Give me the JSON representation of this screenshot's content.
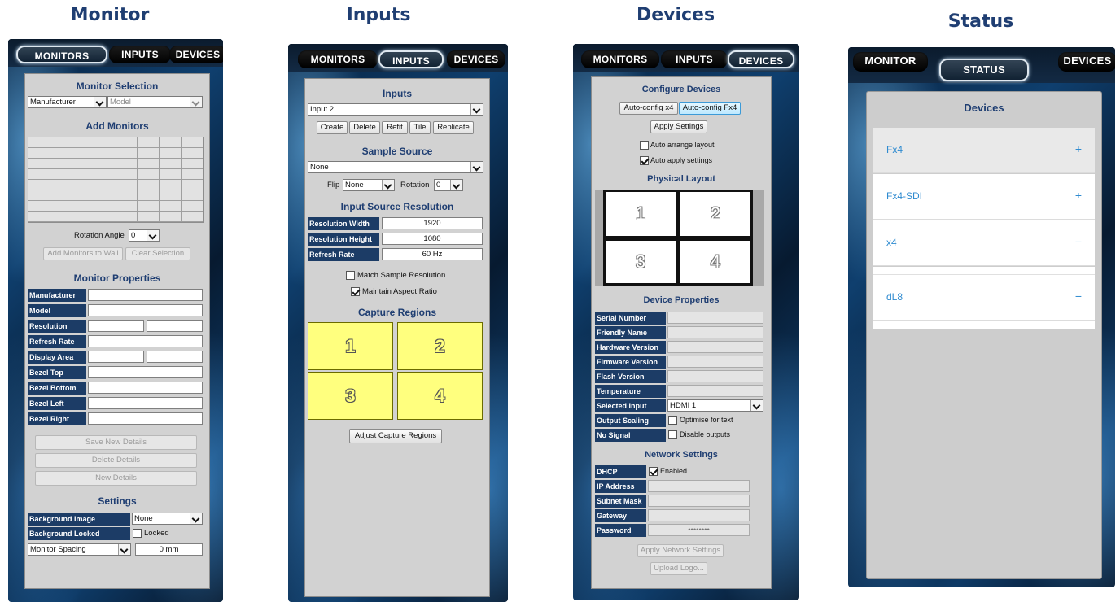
{
  "titles": [
    "Monitor",
    "Inputs",
    "Devices",
    "Status"
  ],
  "tabs": {
    "monitors": "MONITORS",
    "inputs": "INPUTS",
    "devices": "DEVICES",
    "monitor_short": "MONITOR",
    "status": "STATUS"
  },
  "monitor": {
    "selection_title": "Monitor Selection",
    "manufacturer": "Manufacturer",
    "model": "Model",
    "add_title": "Add Monitors",
    "rotation_label": "Rotation Angle",
    "rotation_value": "0",
    "add_wall": "Add Monitors to Wall",
    "clear_selection": "Clear Selection",
    "props_title": "Monitor Properties",
    "props": [
      "Manufacturer",
      "Model",
      "Resolution",
      "Refresh Rate",
      "Display Area",
      "Bezel Top",
      "Bezel Bottom",
      "Bezel Left",
      "Bezel Right"
    ],
    "save": "Save New Details",
    "delete": "Delete Details",
    "new": "New Details",
    "settings_title": "Settings",
    "bg_image_label": "Background Image",
    "bg_image_value": "None",
    "bg_locked_label": "Background Locked",
    "locked": "Locked",
    "spacing_label": "Monitor Spacing",
    "spacing_value": "0 mm"
  },
  "inputs": {
    "title": "Inputs",
    "selected_input": "Input 2",
    "buttons": [
      "Create",
      "Delete",
      "Refit",
      "Tile",
      "Replicate"
    ],
    "sample_title": "Sample Source",
    "sample_value": "None",
    "flip_label": "Flip",
    "flip_value": "None",
    "rotation_label": "Rotation",
    "rotation_value": "0",
    "res_title": "Input Source Resolution",
    "res_rows": [
      {
        "label": "Resolution Width",
        "value": "1920"
      },
      {
        "label": "Resolution Height",
        "value": "1080"
      },
      {
        "label": "Refresh Rate",
        "value": "60 Hz"
      }
    ],
    "match_sample": "Match Sample Resolution",
    "maintain_aspect": "Maintain Aspect Ratio",
    "capture_title": "Capture Regions",
    "regions": [
      "1",
      "2",
      "3",
      "4"
    ],
    "adjust": "Adjust Capture Regions"
  },
  "devices": {
    "config_title": "Configure Devices",
    "auto_x4": "Auto-config x4",
    "auto_fx4": "Auto-config Fx4",
    "apply_settings": "Apply Settings",
    "auto_arrange": "Auto arrange layout",
    "auto_apply": "Auto apply settings",
    "layout_title": "Physical Layout",
    "cells": [
      "1",
      "2",
      "3",
      "4"
    ],
    "props_title": "Device Properties",
    "props": [
      "Serial Number",
      "Friendly Name",
      "Hardware Version",
      "Firmware Version",
      "Flash Version",
      "Temperature"
    ],
    "selected_input_label": "Selected Input",
    "selected_input_value": "HDMI 1",
    "output_scaling_label": "Output Scaling",
    "optimise": "Optimise for text",
    "no_signal_label": "No Signal",
    "disable_outputs": "Disable outputs",
    "net_title": "Network Settings",
    "dhcp_label": "DHCP",
    "enabled": "Enabled",
    "net_fields": [
      "IP Address",
      "Subnet Mask",
      "Gateway"
    ],
    "password_label": "Password",
    "password_value": "••••••••",
    "apply_net": "Apply Network Settings",
    "upload_logo": "Upload Logo..."
  },
  "status": {
    "title": "Devices",
    "items": [
      {
        "name": "Fx4",
        "icon": "+"
      },
      {
        "name": "Fx4-SDI",
        "icon": "+"
      },
      {
        "name": "x4",
        "icon": "−"
      },
      {
        "name": "dL8",
        "icon": "−"
      }
    ]
  }
}
